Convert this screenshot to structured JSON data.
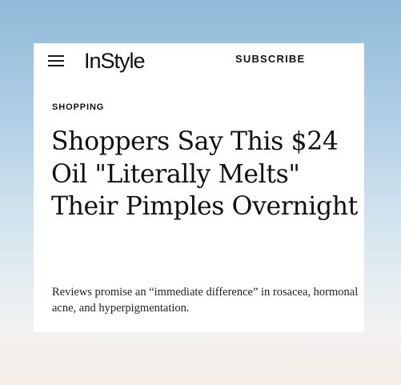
{
  "header": {
    "menu_icon": "hamburger-menu-icon",
    "logo": "InStyle",
    "subscribe_label": "SUBSCRIBE"
  },
  "article": {
    "section": "SHOPPING",
    "headline": "Shoppers Say This $24 Oil \"Literally Melts\" Their Pimples Overnight",
    "dek": "Reviews promise an “immediate difference” in rosacea, hormonal acne, and hyperpigmentation."
  },
  "colors": {
    "background_top": "#8fbad8",
    "background_bottom": "#f5ede6",
    "card": "#ffffff",
    "text": "#111111"
  }
}
